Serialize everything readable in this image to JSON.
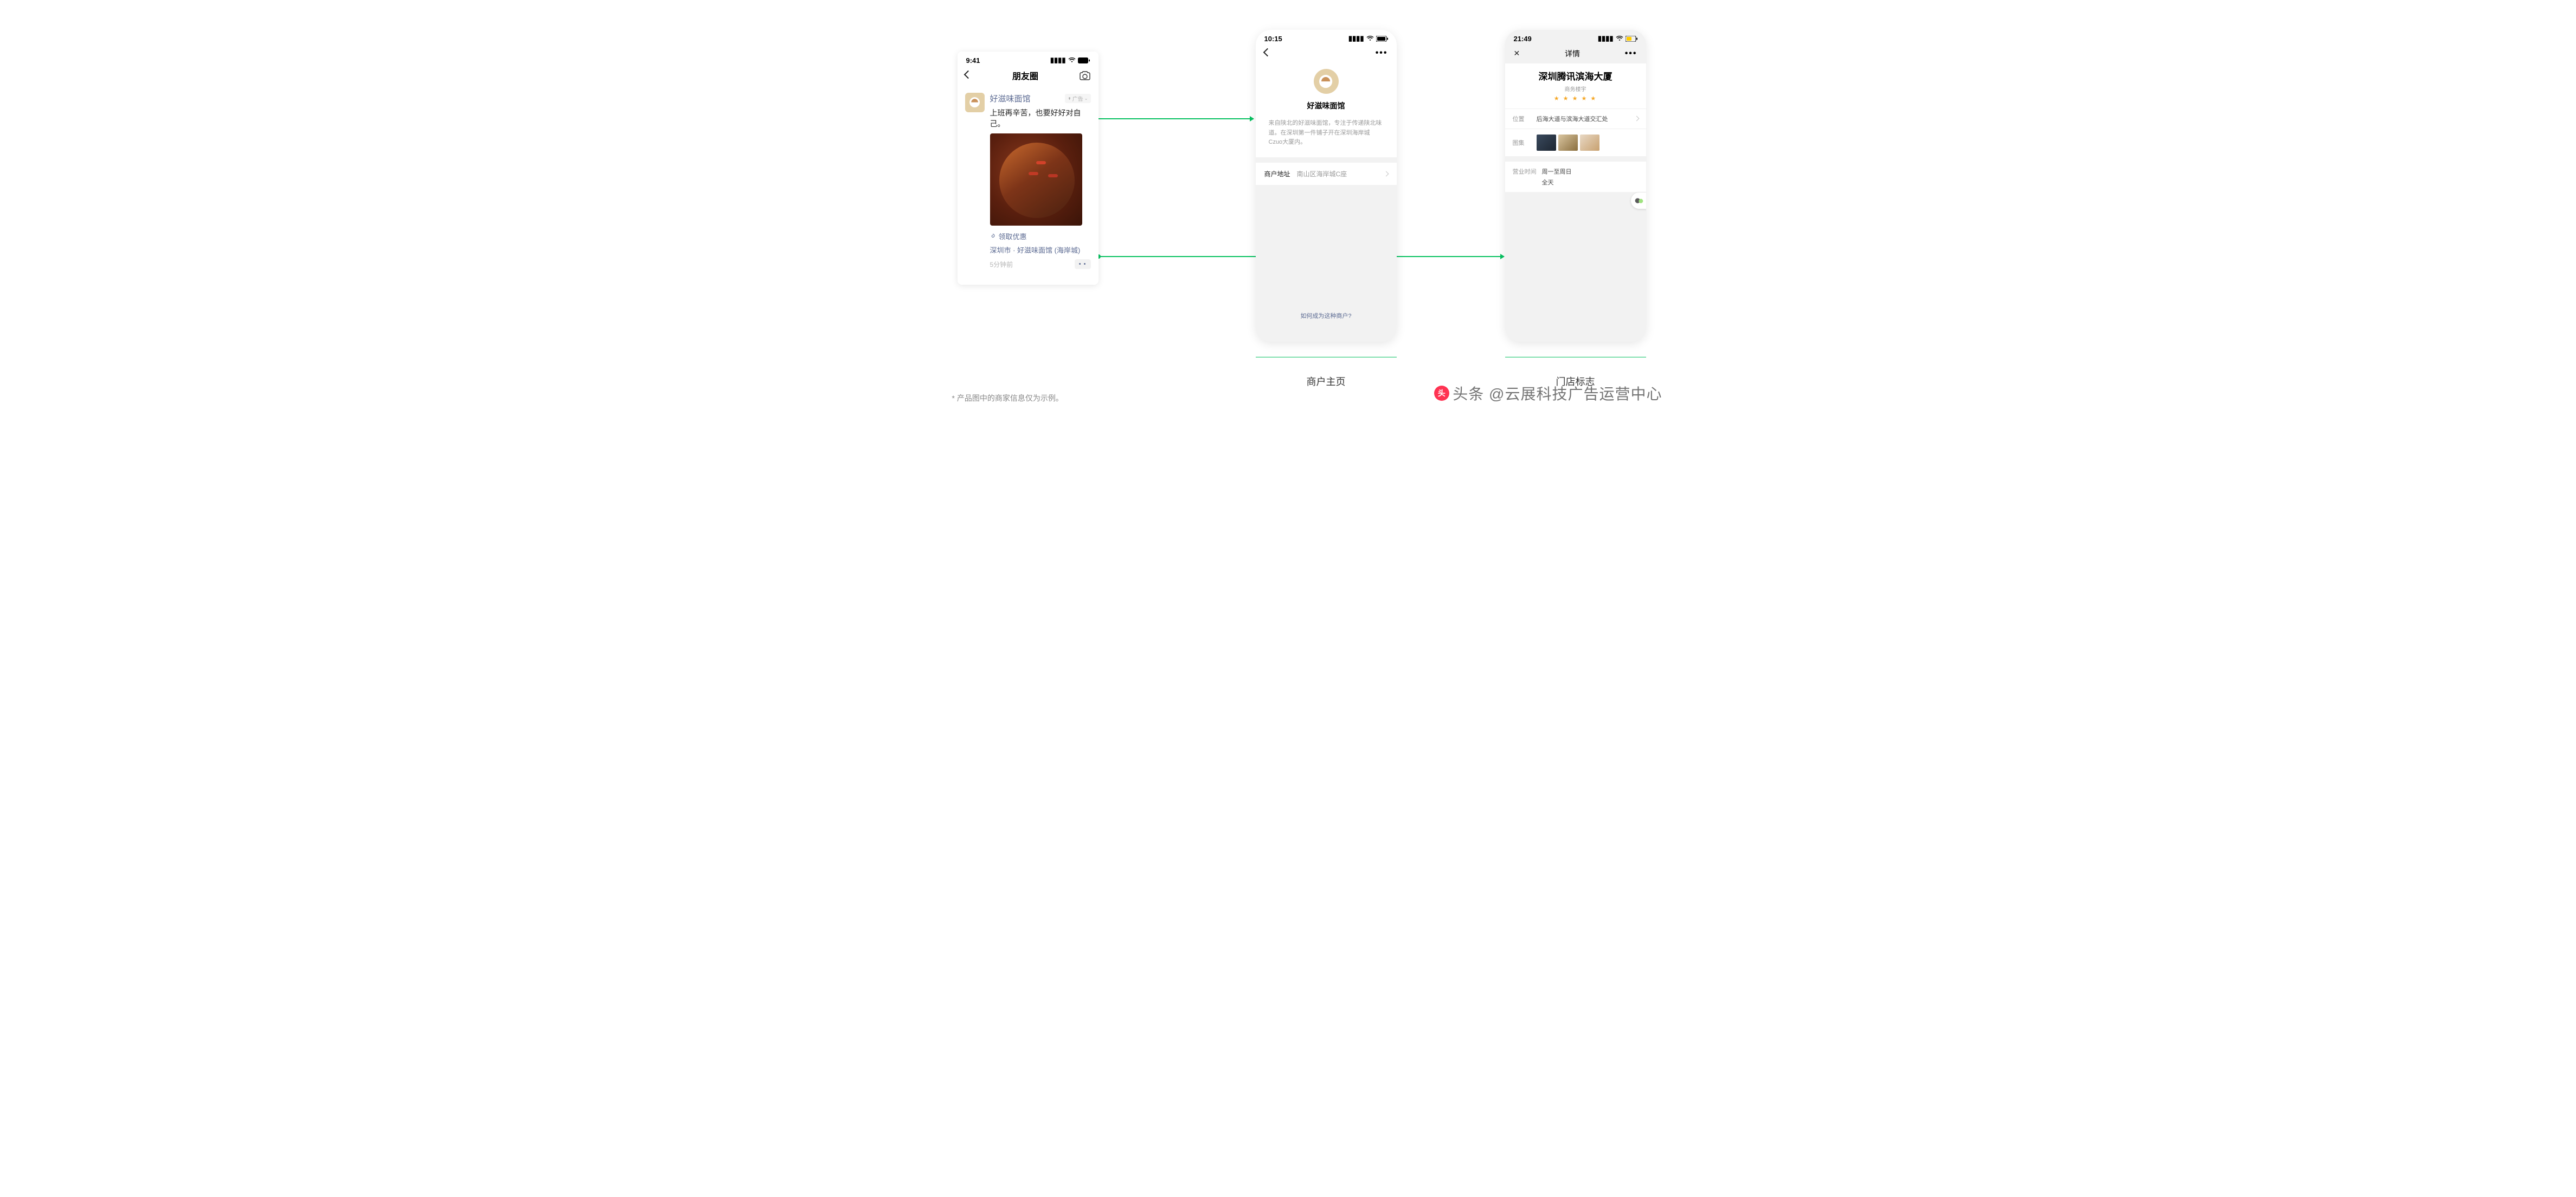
{
  "moments": {
    "status_time": "9:41",
    "nav_title": "朋友圈",
    "brand": "好滋味面馆",
    "ad_tag": "广告",
    "caption": "上班再辛苦，也要好好对自己。",
    "coupon_link": "领取优惠",
    "location": "深圳市 · 好滋味面馆 (海岸城)",
    "time": "5分钟前"
  },
  "merchant": {
    "status_time": "10:15",
    "name": "好滋味面馆",
    "desc": "来自陕北的好滋味面馆，专注于传递陕北味道。在深圳第一件铺子开在深圳海岸城Czuo大厦内。",
    "addr_label": "商户地址",
    "addr_value": "南山区海岸城C座",
    "howto": "如何成为这种商户?",
    "caption": "商户主页"
  },
  "store": {
    "status_time": "21:49",
    "nav_title": "详情",
    "title": "深圳腾讯滨海大厦",
    "subtitle": "商务楼宇",
    "loc_label": "位置",
    "loc_value": "后海大道与滨海大道交汇处",
    "gallery_label": "图集",
    "hours_label": "营业时间",
    "hours_days": "周一至周日",
    "hours_time": "全天",
    "caption": "门店标志"
  },
  "footnote": "* 产品图中的商家信息仅为示例。",
  "watermark": "头条 @云展科技广告运营中心"
}
